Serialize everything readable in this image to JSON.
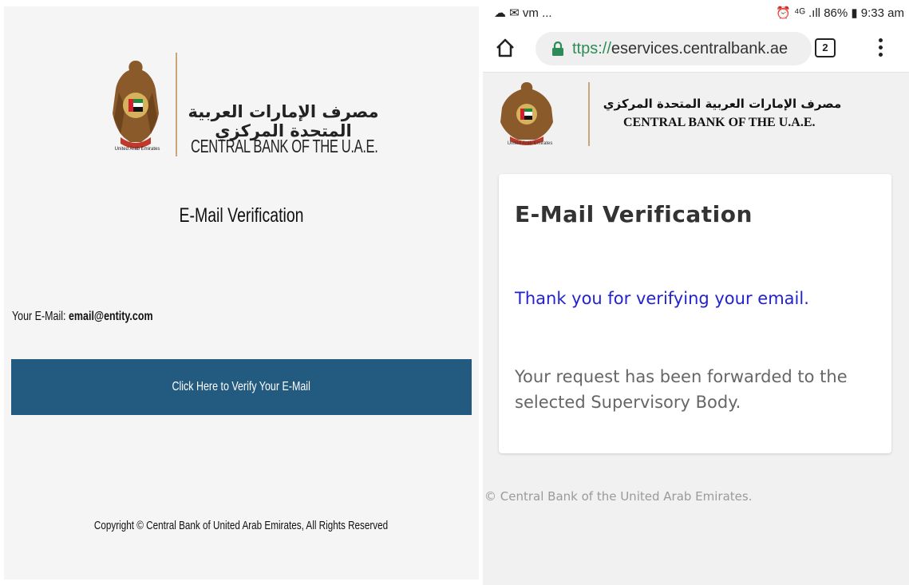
{
  "email": {
    "bank_name_ar": "مصرف الإمارات العربية المتحدة المركزي",
    "bank_name_en": "CENTRAL BANK OF THE U.A.E.",
    "emblem_caption": "United Arab Emirates",
    "title": "E-Mail Verification",
    "email_label": "Your E-Mail:",
    "email_value": "email@entity.com",
    "verify_button_label": "Click Here to Verify Your E-Mail",
    "copyright": "Copyright © Central Bank of United Arab Emirates, All Rights Reserved",
    "colors": {
      "button_bg": "#235a7f",
      "panel_bg": "#f5f5f5"
    }
  },
  "mobile": {
    "statusbar": {
      "left": "vm ...",
      "right": "86% ▮ 9:33 am",
      "signal": "⁴ᴳ .ıll"
    },
    "browser": {
      "url_scheme_fragment": "ttps://",
      "url_host": "eservices.centralbank.ae",
      "tab_count": "2",
      "icons": [
        "home-icon",
        "lock-icon",
        "tabs-icon",
        "overflow-menu-icon"
      ]
    },
    "header": {
      "bank_name_ar": "مصرف الإمارات العربية المتحدة المركزي",
      "bank_name_en": "CENTRAL BANK OF THE U.A.E.",
      "emblem_caption": "United Arab Emirates"
    },
    "card": {
      "title": "E-Mail Verification",
      "thanks": "Thank you for verifying your email.",
      "forwarded": "Your request has been forwarded to the selected Supervisory Body."
    },
    "copyright": "© Central Bank of the United Arab Emirates.",
    "colors": {
      "link_blue": "#2222d0",
      "lock_green": "#2e8b57"
    }
  }
}
